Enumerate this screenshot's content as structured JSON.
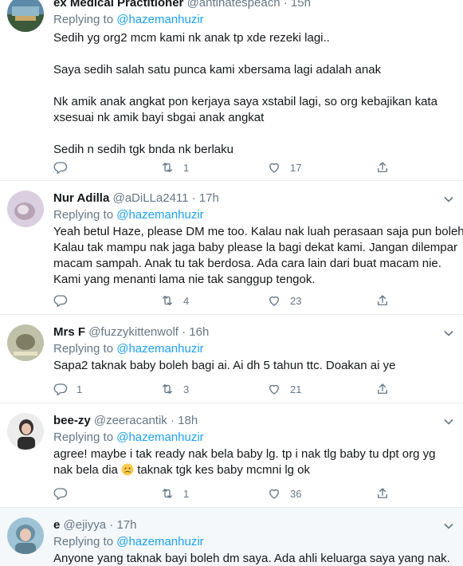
{
  "tweets": [
    {
      "name": "ex Medical Practitioner",
      "handle": "@antihatespeach",
      "dot": "·",
      "time": "15h",
      "replying_label": "Replying to",
      "replying_to": "@hazemanhuzir",
      "lines": [
        "Sedih yg org2 mcm kami nk anak tp xde rezeki lagi..",
        "Saya sedih salah satu punca kami xbersama lagi adalah anak",
        "Nk amik anak angkat pon kerjaya saya xstabil lagi, so org kebajikan kata",
        "xsesuai nk amik bayi sbgai anak angkat",
        "Sedih n sedih tgk bnda nk berlaku"
      ],
      "replies": "",
      "retweets": "1",
      "likes": "17"
    },
    {
      "name": "Nur Adilla",
      "handle": "@aDiLLa2411",
      "dot": "·",
      "time": "17h",
      "replying_label": "Replying to",
      "replying_to": "@hazemanhuzir",
      "lines": [
        "Yeah betul Haze, please DM me too. Kalau nak luah perasaan saja pun boleh.",
        "Kalau tak mampu nak jaga baby please la bagi dekat kami. Jangan dilempar",
        "macam sampah. Anak tu tak berdosa. Ada cara lain dari buat macam nie.",
        "Kami yang menanti lama nie tak sanggup tengok."
      ],
      "replies": "",
      "retweets": "4",
      "likes": "23"
    },
    {
      "name": "Mrs F",
      "handle": "@fuzzykittenwolf",
      "dot": "·",
      "time": "16h",
      "replying_label": "Replying to",
      "replying_to": "@hazemanhuzir",
      "lines": [
        "Sapa2 taknak baby boleh bagi ai. Ai dh 5 tahun ttc. Doakan ai ye"
      ],
      "replies": "1",
      "retweets": "3",
      "likes": "21"
    },
    {
      "name": "bee-zy",
      "handle": "@zeeracantik",
      "dot": "·",
      "time": "18h",
      "replying_label": "Replying to",
      "replying_to": "@hazemanhuzir",
      "lines": [
        "agree! maybe i tak ready nak bela baby lg. tp i nak tlg baby tu dpt org yg"
      ],
      "line2_before": "nak bela dia",
      "line2_after": "taknak tgk kes baby mcmni lg ok",
      "emoji": "sad-face-emoji",
      "replies": "",
      "retweets": "1",
      "likes": "36"
    },
    {
      "name": "e",
      "handle": "@ejiyya",
      "dot": "·",
      "time": "17h",
      "replying_label": "Replying to",
      "replying_to": "@hazemanhuzir",
      "lines": [
        "Anyone yang taknak bayi boleh dm saya. Ada ahli keluarga saya yang nak."
      ]
    }
  ],
  "colors": {
    "link": "#1da1f2",
    "muted": "#657786",
    "text": "#14171a",
    "border": "#e6ecf0",
    "highlight_bg": "#f5f8fa"
  },
  "icons": [
    "reply-icon",
    "retweet-icon",
    "like-icon",
    "share-icon",
    "chevron-down-icon"
  ]
}
